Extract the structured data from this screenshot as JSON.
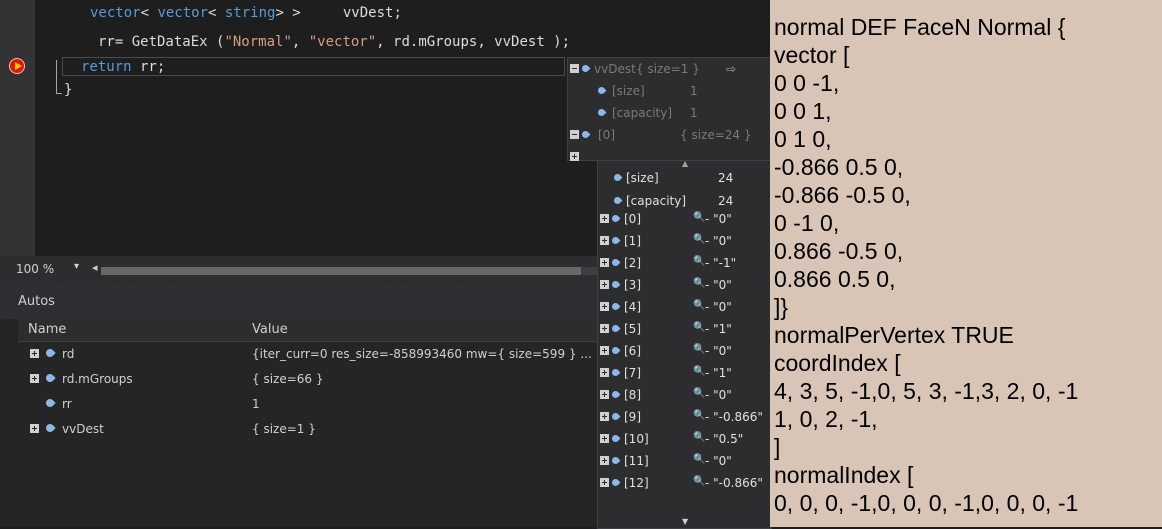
{
  "editor": {
    "line1": {
      "kw1": "vector",
      "a": "< ",
      "kw2": "vector",
      "b": "< ",
      "kw3": "string",
      "c": "> >     vvDest;"
    },
    "line2": {
      "a": "rr= GetDataEx (",
      "s1": "\"Normal\"",
      "b": ", ",
      "s2": "\"vector\"",
      "c": ", rd.mGroups, vvDest );"
    },
    "line3": {
      "kw": "return",
      "rest": " rr;"
    },
    "line4": "}"
  },
  "zoom": {
    "level": "100 %",
    "dropdown": "▾",
    "scroll_left": "◂"
  },
  "autos": {
    "title": "Autos",
    "columns": {
      "name": "Name",
      "value": "Value"
    },
    "rows": [
      {
        "name": "rd",
        "value": "{iter_curr=0 res_size=-858993460 mw={ size=599 } ...",
        "expandable": true
      },
      {
        "name": "rd.mGroups",
        "value": "{ size=66 }",
        "expandable": true
      },
      {
        "name": "rr",
        "value": "1",
        "expandable": false
      },
      {
        "name": "vvDest",
        "value": "{ size=1 }",
        "expandable": true
      }
    ]
  },
  "datatip": {
    "root": {
      "name": "vvDest",
      "value": "{ size=1 }",
      "pin": "⇨"
    },
    "rows": [
      {
        "name": "[size]",
        "value": "1"
      },
      {
        "name": "[capacity]",
        "value": "1"
      },
      {
        "name": "[0]",
        "value": "{ size=24 }"
      }
    ]
  },
  "subtip": {
    "scroll_up": "▲",
    "scroll_down": "▼",
    "magnifier": "🔍",
    "rows": [
      {
        "name": "[size]",
        "value": "24",
        "plain": true
      },
      {
        "name": "[capacity]",
        "value": "24",
        "plain": true
      },
      {
        "name": "[0]",
        "value": "- \"0\""
      },
      {
        "name": "[1]",
        "value": "- \"0\""
      },
      {
        "name": "[2]",
        "value": "- \"-1\""
      },
      {
        "name": "[3]",
        "value": "- \"0\""
      },
      {
        "name": "[4]",
        "value": "- \"0\""
      },
      {
        "name": "[5]",
        "value": "- \"1\""
      },
      {
        "name": "[6]",
        "value": "- \"0\""
      },
      {
        "name": "[7]",
        "value": "- \"1\""
      },
      {
        "name": "[8]",
        "value": "- \"0\""
      },
      {
        "name": "[9]",
        "value": "- \"-0.866\""
      },
      {
        "name": "[10]",
        "value": "- \"0.5\""
      },
      {
        "name": "[11]",
        "value": "- \"0\""
      },
      {
        "name": "[12]",
        "value": "- \"-0.866\""
      }
    ]
  },
  "vrml_lines": [
    "normal DEF FaceN Normal {",
    "vector  [",
    "0 0 -1,",
    "0 0 1,",
    "0 1 0,",
    "-0.866 0.5 0,",
    "-0.866 -0.5 0,",
    "0 -1 0,",
    "0.866 -0.5 0,",
    "0.866 0.5 0,",
    "]}",
    "normalPerVertex TRUE",
    "coordIndex [",
    "4, 3, 5, -1,0, 5, 3, -1,3, 2, 0, -1",
    "1, 0, 2, -1,",
    "]",
    "normalIndex [",
    "0, 0, 0, -1,0, 0, 0, -1,0, 0, 0, -1"
  ]
}
